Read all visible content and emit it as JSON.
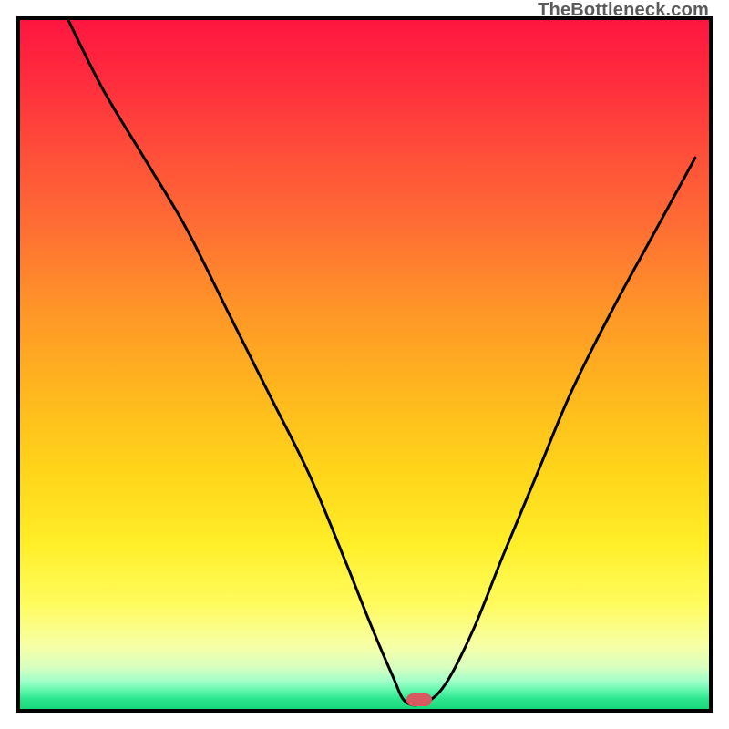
{
  "watermark": "TheBottleneck.com",
  "colors": {
    "border": "#000000",
    "marker": "#d85a60",
    "curve": "#000000",
    "gradient_top": "#ff1640",
    "gradient_mid": "#ffd61a",
    "gradient_bottom": "#18d87a"
  },
  "chart_data": {
    "type": "line",
    "title": "",
    "xlabel": "",
    "ylabel": "",
    "xlim": [
      0,
      100
    ],
    "ylim": [
      0,
      100
    ],
    "grid": false,
    "legend": false,
    "series": [
      {
        "name": "bottleneck-curve",
        "x": [
          7,
          12,
          18,
          24,
          30,
          36,
          42,
          47,
          51,
          54,
          56,
          59,
          62,
          66,
          70,
          75,
          80,
          86,
          92,
          98
        ],
        "values": [
          100,
          90,
          80,
          70,
          58,
          46,
          34,
          22,
          12,
          5,
          1,
          1,
          4,
          12,
          22,
          34,
          46,
          58,
          69,
          80
        ]
      }
    ],
    "marker": {
      "x": 58,
      "y": 1
    },
    "annotations": []
  }
}
